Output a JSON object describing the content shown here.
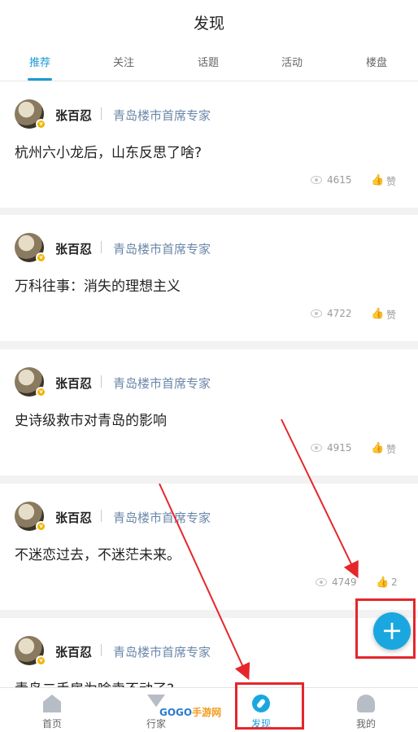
{
  "header": {
    "title": "发现"
  },
  "tabs": [
    {
      "label": "推荐",
      "active": true
    },
    {
      "label": "关注",
      "active": false
    },
    {
      "label": "话题",
      "active": false
    },
    {
      "label": "活动",
      "active": false
    },
    {
      "label": "楼盘",
      "active": false
    }
  ],
  "posts": [
    {
      "author": "张百忍",
      "role": "青岛楼市首席专家",
      "title": "杭州六小龙后，山东反思了啥?",
      "views": "4615",
      "likes": "赞"
    },
    {
      "author": "张百忍",
      "role": "青岛楼市首席专家",
      "title": "万科往事：消失的理想主义",
      "views": "4722",
      "likes": "赞"
    },
    {
      "author": "张百忍",
      "role": "青岛楼市首席专家",
      "title": "史诗级救市对青岛的影响",
      "views": "4915",
      "likes": "赞"
    },
    {
      "author": "张百忍",
      "role": "青岛楼市首席专家",
      "title": "不迷恋过去，不迷茫未来。",
      "views": "4749",
      "likes": "2"
    },
    {
      "author": "张百忍",
      "role": "青岛楼市首席专家",
      "title": "青岛二手房为啥卖不动了?",
      "views": "",
      "likes": ""
    }
  ],
  "fab": {
    "symbol": "+"
  },
  "bottom_nav": [
    {
      "label": "首页",
      "icon": "home-icon",
      "active": false
    },
    {
      "label": "行家",
      "icon": "market-icon",
      "active": false
    },
    {
      "label": "发现",
      "icon": "compass-icon",
      "active": true
    },
    {
      "label": "我的",
      "icon": "profile-icon",
      "active": false
    }
  ],
  "watermark": {
    "part1": "GOGO",
    "part2": "手游网"
  },
  "colors": {
    "accent": "#1a9bd7",
    "highlight_box": "#e5262a",
    "role_text": "#6a87a8"
  }
}
